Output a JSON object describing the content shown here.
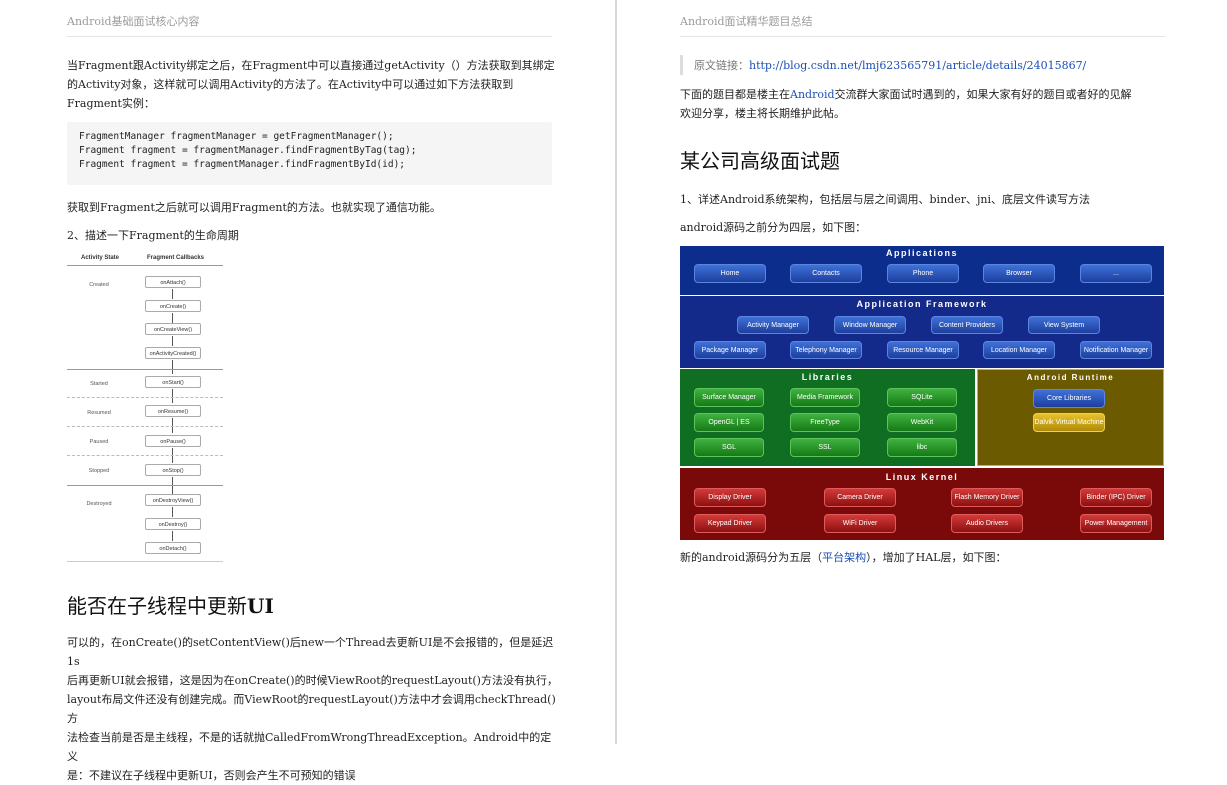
{
  "left": {
    "header": "Android基础面试核心内容",
    "para1": [
      "当Fragment跟Activity绑定之后，在Fragment中可以直接通过getActivity（）方法获取到其绑定",
      "的Activity对象，这样就可以调用Activity的方法了。在Activity中可以通过如下方法获取到",
      "Fragment实例："
    ],
    "code": [
      "FragmentManager fragmentManager = getFragmentManager();",
      "Fragment fragment = fragmentManager.findFragmentByTag(tag);",
      "Fragment fragment = fragmentManager.findFragmentById(id);"
    ],
    "para2": "获取到Fragment之后就可以调用Fragment的方法。也就实现了通信功能。",
    "item2": "2、描述一下Fragment的生命周期",
    "lifecycle": {
      "col_state": "Activity State",
      "col_callbacks": "Fragment Callbacks",
      "states": [
        "Created",
        "Started",
        "Resumed",
        "Paused",
        "Stopped",
        "Destroyed"
      ],
      "callbacks": [
        "onAttach()",
        "onCreate()",
        "onCreateView()",
        "onActivityCreated()",
        "onStart()",
        "onResume()",
        "onPause()",
        "onStop()",
        "onDestroyView()",
        "onDestroy()",
        "onDetach()"
      ]
    },
    "section_title_prefix": "能否在子线程中更新",
    "section_title_bold": "UI",
    "para3": [
      "可以的，在onCreate()的setContentView()后new一个Thread去更新UI是不会报错的，但是延迟1s",
      "后再更新UI就会报错，这是因为在onCreate()的时候ViewRoot的requestLayout()方法没有执行，",
      "layout布局文件还没有创建完成。而ViewRoot的requestLayout()方法中才会调用checkThread()方",
      "法检查当前是否是主线程，不是的话就抛CalledFromWrongThreadException。Android中的定义",
      "是：不建议在子线程中更新UI，否则会产生不可预知的错误"
    ]
  },
  "right": {
    "header": "Android面试精华题目总结",
    "quote_label": "原文链接：",
    "quote_link": "http://blog.csdn.net/lmj623565791/article/details/24015867/",
    "intro_pre": "下面的题目都是楼主在",
    "intro_link": "Android",
    "intro_post": "交流群大家面试时遇到的，如果大家有好的题目或者好的见解",
    "intro_line2": "欢迎分享，楼主将长期维护此帖。",
    "section_title": "某公司高级面试题",
    "q1": "1、详述Android系统架构，包括层与层之间调用、binder、jni、底层文件读写方法",
    "q1_desc": "android源码之前分为四层，如下图：",
    "arch": {
      "applications": "Applications",
      "apps": [
        "Home",
        "Contacts",
        "Phone",
        "Browser",
        "..."
      ],
      "framework": "Application Framework",
      "fw_row1": [
        "Activity Manager",
        "Window Manager",
        "Content Providers",
        "View System"
      ],
      "fw_row2": [
        "Package Manager",
        "Telephony Manager",
        "Resource Manager",
        "Location Manager",
        "Notification Manager"
      ],
      "libraries": "Libraries",
      "libs": [
        "Surface Manager",
        "Media Framework",
        "SQLite",
        "OpenGL | ES",
        "FreeType",
        "WebKit",
        "SGL",
        "SSL",
        "libc"
      ],
      "runtime": "Android Runtime",
      "runtime_items": [
        "Core Libraries",
        "Dalvik Virtual Machine"
      ],
      "kernel": "Linux Kernel",
      "kernel_items": [
        "Display Driver",
        "Camera Driver",
        "Flash Memory Driver",
        "Binder (IPC) Driver",
        "Keypad Driver",
        "WiFi Driver",
        "Audio Drivers",
        "Power Management"
      ],
      "colors": {
        "apps_band": "#0d2d8c",
        "framework_band": "#142a8a",
        "libraries_band": "#0f6e22",
        "runtime_band": "#6b5a00",
        "kernel_band": "#7a0a0a"
      }
    },
    "new_pre": "新的android源码分为五层（",
    "new_link": "平台架构",
    "new_post": "），增加了HAL层，如下图："
  }
}
